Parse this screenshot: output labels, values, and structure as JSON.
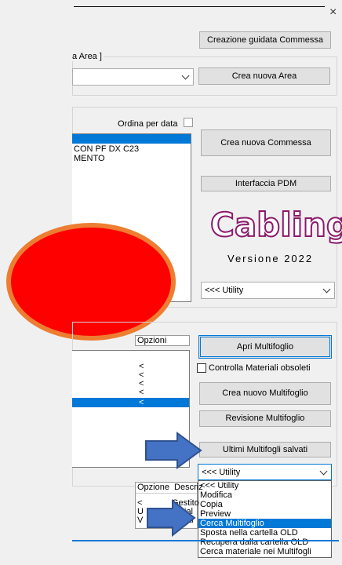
{
  "window": {
    "close_glyph": "×"
  },
  "buttons": {
    "wizard": "Creazione guidata Commessa",
    "new_area": "Crea nuova Area",
    "new_commessa": "Crea nuova Commessa",
    "pdm": "Interfaccia PDM",
    "open_multi": "Apri Multifoglio",
    "new_multi": "Crea nuovo Multifoglio",
    "revision": "Revisione Multifoglio",
    "recent": "Ultimi Multifogli salvati"
  },
  "area": {
    "group_label": "a Area ]",
    "combo_value": ""
  },
  "commessa": {
    "sort_label": "Ordina per data",
    "lines": [
      "CON PF DX C23",
      "MENTO"
    ]
  },
  "logo": {
    "text": "Cabling",
    "version": "Versione 2022"
  },
  "utility_combo_top": {
    "value": "<<< Utility"
  },
  "multifoglio": {
    "options_header": "Opzioni",
    "markers": [
      "<",
      "<",
      "<",
      "<",
      "<"
    ],
    "obsolete_label": "Controlla Materiali obsoleti"
  },
  "utility_combo_bottom": {
    "value": "<<< Utility",
    "options": [
      "<<< Utility",
      "Modifica",
      "Copia",
      "Preview",
      "Cerca Multifoglio",
      "Sposta nella cartella OLD",
      "Recupera dalla cartella OLD",
      "Cerca materiale nei Multifogli"
    ],
    "selected": "Cerca Multifoglio"
  },
  "bottom_table": {
    "headers": [
      "Opzione",
      "Descriz"
    ],
    "rows": [
      {
        "c1": "<",
        "c2": "Gestito"
      },
      {
        "c1": "U",
        "c2": "ial"
      },
      {
        "c1": "V",
        "c2": "ati"
      }
    ]
  },
  "colors": {
    "accent": "#0078d7",
    "circle": "#fe0000",
    "circle_border": "#ed7d31",
    "arrow": "#4472c4",
    "logo": "#8b1a6b"
  }
}
